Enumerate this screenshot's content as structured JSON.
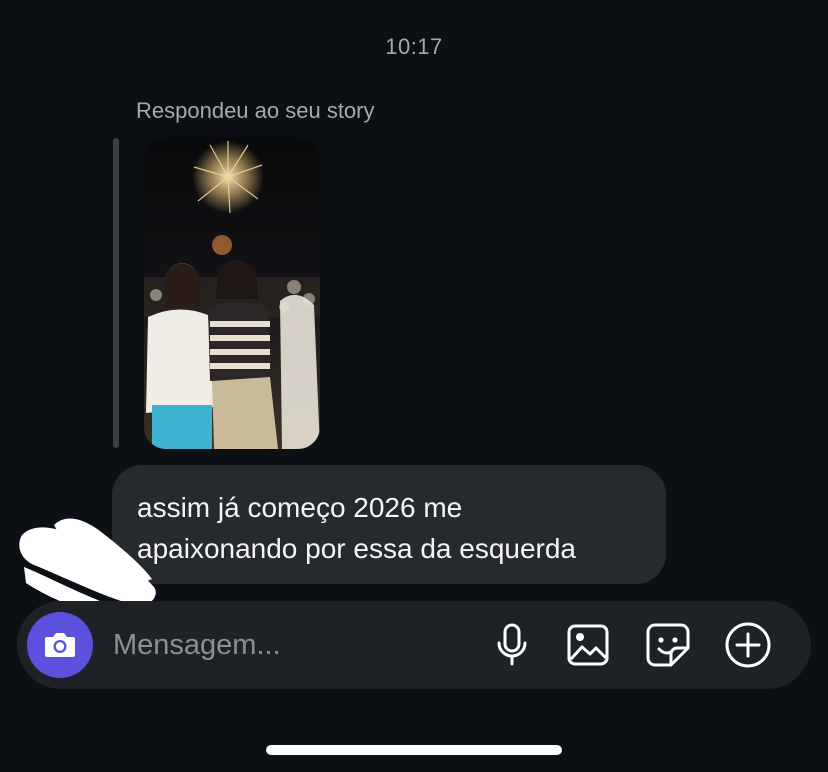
{
  "thread": {
    "timestamp": "10:17",
    "reply_label": "Respondeu ao seu story",
    "story_preview": {
      "description_icon": "story-photo"
    },
    "message": {
      "line1": "assim já começo 2026 me",
      "line2": "apaixonando por essa da esquerda"
    }
  },
  "composer": {
    "placeholder": "Mensagem...",
    "icons": [
      "camera-icon",
      "microphone-icon",
      "gallery-icon",
      "sticker-icon",
      "plus-circle-icon"
    ]
  },
  "colors": {
    "background": "#0c1014",
    "bubble": "#262a2f",
    "composer": "#1e2227",
    "camera_button": "#5b51de",
    "secondary_text": "#a8a8a8"
  }
}
